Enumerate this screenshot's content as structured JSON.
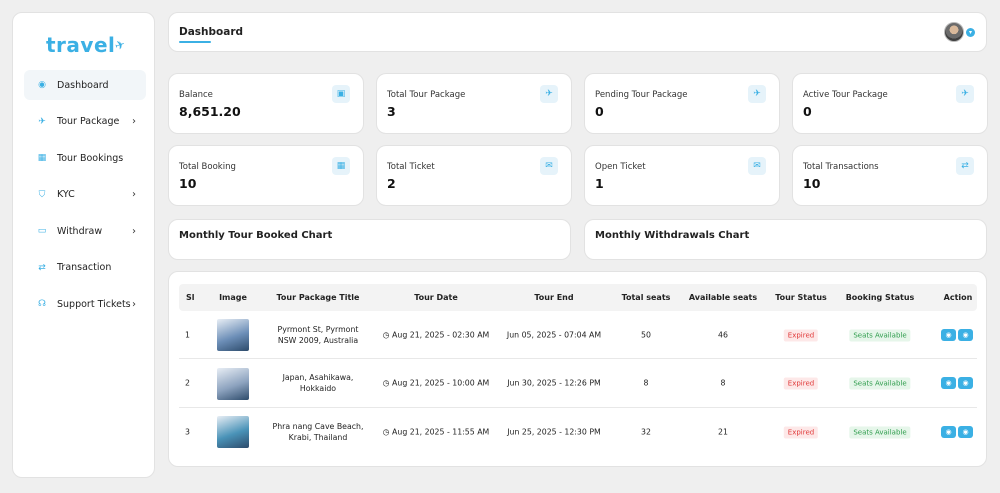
{
  "brand": {
    "name": "travel"
  },
  "sidebar": {
    "items": [
      {
        "label": "Dashboard",
        "icon": "dashboard-icon",
        "glyph": "◉",
        "active": true,
        "chevron": false
      },
      {
        "label": "Tour Package",
        "icon": "plane-icon",
        "glyph": "✈",
        "active": false,
        "chevron": true
      },
      {
        "label": "Tour Bookings",
        "icon": "calendar-icon",
        "glyph": "▦",
        "active": false,
        "chevron": false
      },
      {
        "label": "KYC",
        "icon": "shield-icon",
        "glyph": "⛉",
        "active": false,
        "chevron": true
      },
      {
        "label": "Withdraw",
        "icon": "card-icon",
        "glyph": "▭",
        "active": false,
        "chevron": true
      },
      {
        "label": "Transaction",
        "icon": "exchange-icon",
        "glyph": "⇄",
        "active": false,
        "chevron": false
      },
      {
        "label": "Support Tickets",
        "icon": "headset-icon",
        "glyph": "☊",
        "active": false,
        "chevron": true
      }
    ]
  },
  "header": {
    "title": "Dashboard"
  },
  "stats": [
    {
      "label": "Balance",
      "value": "8,651.20",
      "icon": "money-icon",
      "glyph": "▣"
    },
    {
      "label": "Total Tour Package",
      "value": "3",
      "icon": "plane-icon",
      "glyph": "✈"
    },
    {
      "label": "Pending Tour Package",
      "value": "0",
      "icon": "plane-icon",
      "glyph": "✈"
    },
    {
      "label": "Active Tour Package",
      "value": "0",
      "icon": "plane-icon",
      "glyph": "✈"
    },
    {
      "label": "Total Booking",
      "value": "10",
      "icon": "calendar-icon",
      "glyph": "▦"
    },
    {
      "label": "Total Ticket",
      "value": "2",
      "icon": "envelope-icon",
      "glyph": "✉"
    },
    {
      "label": "Open Ticket",
      "value": "1",
      "icon": "envelope-icon",
      "glyph": "✉"
    },
    {
      "label": "Total Transactions",
      "value": "10",
      "icon": "exchange-icon",
      "glyph": "⇄"
    }
  ],
  "charts": {
    "tour_booked": "Monthly Tour Booked Chart",
    "withdrawals": "Monthly Withdrawals Chart"
  },
  "table": {
    "headers": [
      "Sl",
      "Image",
      "Tour Package Title",
      "Tour Date",
      "Tour End",
      "Total seats",
      "Available seats",
      "Tour Status",
      "Booking Status",
      "Action"
    ],
    "rows": [
      {
        "sl": "1",
        "title": "Pyrmont St, Pyrmont NSW 2009, Australia",
        "date": "Aug 21, 2025 - 02:30 AM",
        "end": "Jun 05, 2025 - 07:04 AM",
        "total": "50",
        "available": "46",
        "status": "Expired",
        "booking": "Seats Available",
        "thumb": "#6d8fb8"
      },
      {
        "sl": "2",
        "title": "Japan, Asahikawa, Hokkaido",
        "date": "Aug 21, 2025 - 10:00 AM",
        "end": "Jun 30, 2025 - 12:26 PM",
        "total": "8",
        "available": "8",
        "status": "Expired",
        "booking": "Seats Available",
        "thumb": "#8da3bf"
      },
      {
        "sl": "3",
        "title": "Phra nang Cave Beach, Krabi, Thailand",
        "date": "Aug 21, 2025 - 11:55 AM",
        "end": "Jun 25, 2025 - 12:30 PM",
        "total": "32",
        "available": "21",
        "status": "Expired",
        "booking": "Seats Available",
        "thumb": "#4a93b8"
      }
    ]
  },
  "colors": {
    "accent": "#3bb0e4",
    "expired": "#e03a3a",
    "available": "#2e9c4c"
  }
}
